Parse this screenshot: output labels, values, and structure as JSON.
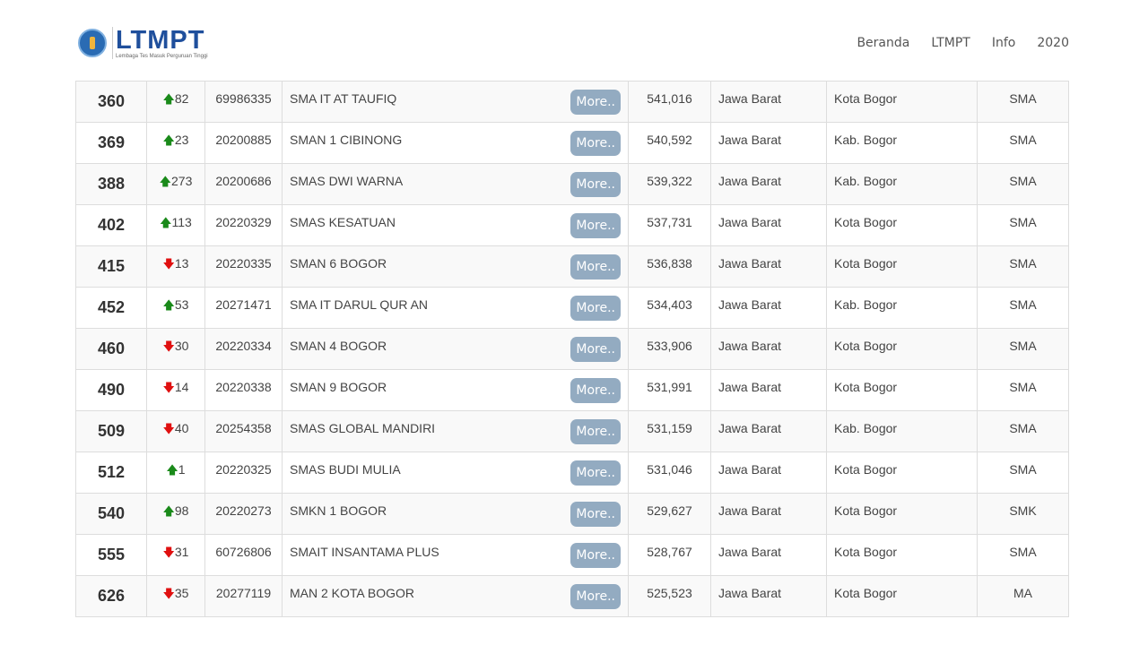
{
  "header": {
    "logo_text": "LTMPT",
    "logo_subtitle": "Lembaga Tes Masuk Perguruan Tinggi",
    "nav": [
      "Beranda",
      "LTMPT",
      "Info",
      "2020"
    ]
  },
  "colors": {
    "up": "#1a8a1a",
    "down": "#e01010",
    "more_button": "#93abc1",
    "logo": "#1f4f9c"
  },
  "more_label": "More..",
  "rows": [
    {
      "rank": "360",
      "dir": "up",
      "change": "82",
      "npsn": "69986335",
      "name": "SMA IT AT TAUFIQ",
      "score": "541,016",
      "province": "Jawa Barat",
      "city": "Kota Bogor",
      "type": "SMA"
    },
    {
      "rank": "369",
      "dir": "up",
      "change": "23",
      "npsn": "20200885",
      "name": "SMAN 1 CIBINONG",
      "score": "540,592",
      "province": "Jawa Barat",
      "city": "Kab. Bogor",
      "type": "SMA"
    },
    {
      "rank": "388",
      "dir": "up",
      "change": "273",
      "npsn": "20200686",
      "name": "SMAS DWI WARNA",
      "score": "539,322",
      "province": "Jawa Barat",
      "city": "Kab. Bogor",
      "type": "SMA"
    },
    {
      "rank": "402",
      "dir": "up",
      "change": "113",
      "npsn": "20220329",
      "name": "SMAS KESATUAN",
      "score": "537,731",
      "province": "Jawa Barat",
      "city": "Kota Bogor",
      "type": "SMA"
    },
    {
      "rank": "415",
      "dir": "down",
      "change": "13",
      "npsn": "20220335",
      "name": "SMAN 6 BOGOR",
      "score": "536,838",
      "province": "Jawa Barat",
      "city": "Kota Bogor",
      "type": "SMA"
    },
    {
      "rank": "452",
      "dir": "up",
      "change": "53",
      "npsn": "20271471",
      "name": "SMA IT DARUL QUR AN",
      "score": "534,403",
      "province": "Jawa Barat",
      "city": "Kab. Bogor",
      "type": "SMA"
    },
    {
      "rank": "460",
      "dir": "down",
      "change": "30",
      "npsn": "20220334",
      "name": "SMAN 4 BOGOR",
      "score": "533,906",
      "province": "Jawa Barat",
      "city": "Kota Bogor",
      "type": "SMA"
    },
    {
      "rank": "490",
      "dir": "down",
      "change": "14",
      "npsn": "20220338",
      "name": "SMAN 9 BOGOR",
      "score": "531,991",
      "province": "Jawa Barat",
      "city": "Kota Bogor",
      "type": "SMA"
    },
    {
      "rank": "509",
      "dir": "down",
      "change": "40",
      "npsn": "20254358",
      "name": "SMAS GLOBAL MANDIRI",
      "score": "531,159",
      "province": "Jawa Barat",
      "city": "Kab. Bogor",
      "type": "SMA"
    },
    {
      "rank": "512",
      "dir": "up",
      "change": "1",
      "npsn": "20220325",
      "name": "SMAS BUDI MULIA",
      "score": "531,046",
      "province": "Jawa Barat",
      "city": "Kota Bogor",
      "type": "SMA"
    },
    {
      "rank": "540",
      "dir": "up",
      "change": "98",
      "npsn": "20220273",
      "name": "SMKN 1 BOGOR",
      "score": "529,627",
      "province": "Jawa Barat",
      "city": "Kota Bogor",
      "type": "SMK"
    },
    {
      "rank": "555",
      "dir": "down",
      "change": "31",
      "npsn": "60726806",
      "name": "SMAIT INSANTAMA PLUS",
      "score": "528,767",
      "province": "Jawa Barat",
      "city": "Kota Bogor",
      "type": "SMA"
    },
    {
      "rank": "626",
      "dir": "down",
      "change": "35",
      "npsn": "20277119",
      "name": "MAN 2 KOTA BOGOR",
      "score": "525,523",
      "province": "Jawa Barat",
      "city": "Kota Bogor",
      "type": "MA"
    }
  ]
}
